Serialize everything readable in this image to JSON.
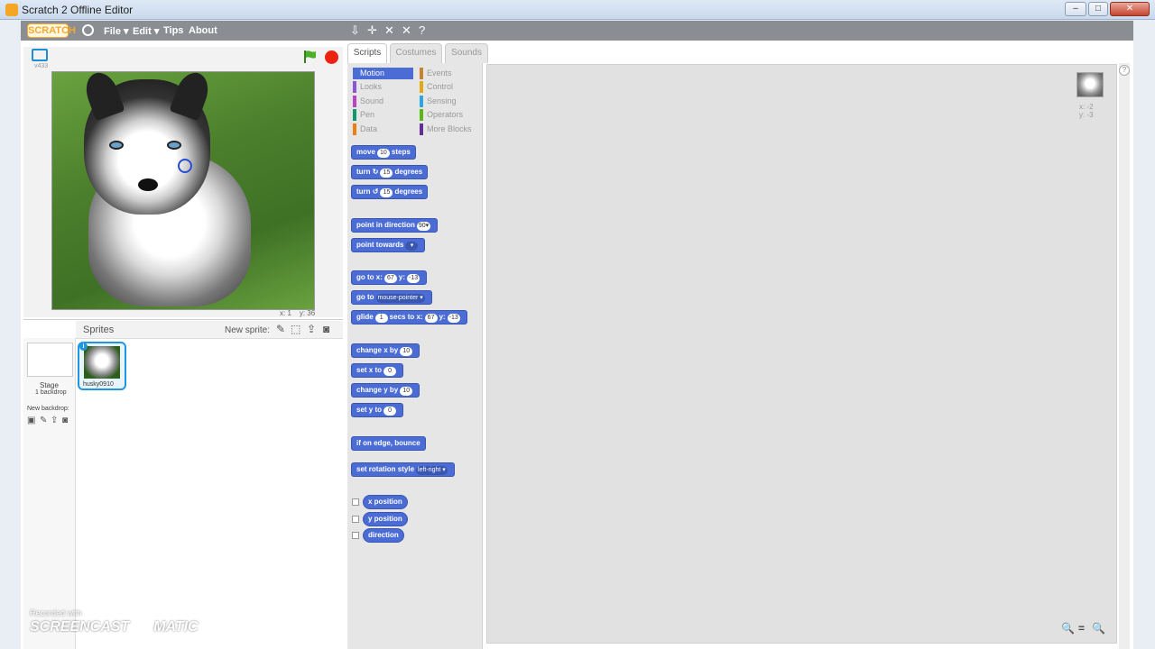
{
  "window": {
    "title": "Scratch 2 Offline Editor",
    "controls": [
      "–",
      "□",
      "✕"
    ]
  },
  "menubar": {
    "logo": "SCRATCH",
    "menus": [
      "File ▾",
      "Edit ▾",
      "Tips",
      "About"
    ],
    "tools": [
      "⇩",
      "✛",
      "✕",
      "✕",
      "?"
    ]
  },
  "stage": {
    "version": "v433",
    "mouse_x_label": "x:",
    "mouse_x": "1",
    "mouse_y_label": "y:",
    "mouse_y": "36"
  },
  "sprites_panel": {
    "title": "Sprites",
    "new_sprite_label": "New sprite:",
    "stage_label": "Stage",
    "backdrop_count": "1 backdrop",
    "new_backdrop_label": "New backdrop:",
    "sprite_name": "husky0910"
  },
  "tabs": [
    "Scripts",
    "Costumes",
    "Sounds"
  ],
  "categories": [
    {
      "label": "Motion",
      "color": "#4a6cd4"
    },
    {
      "label": "Looks",
      "color": "#8a55d7"
    },
    {
      "label": "Sound",
      "color": "#bb42c3"
    },
    {
      "label": "Pen",
      "color": "#0e9a6c"
    },
    {
      "label": "Data",
      "color": "#ee7d16"
    },
    {
      "label": "Events",
      "color": "#c88330"
    },
    {
      "label": "Control",
      "color": "#e1a91a"
    },
    {
      "label": "Sensing",
      "color": "#2ca5e2"
    },
    {
      "label": "Operators",
      "color": "#5cb712"
    },
    {
      "label": "More Blocks",
      "color": "#632d99"
    }
  ],
  "blocks": {
    "move": {
      "a": "move",
      "v": "10",
      "b": "steps"
    },
    "turn_cw": {
      "a": "turn ↻",
      "v": "15",
      "b": "degrees"
    },
    "turn_ccw": {
      "a": "turn ↺",
      "v": "15",
      "b": "degrees"
    },
    "point_dir": {
      "a": "point in direction",
      "v": "90▾"
    },
    "point_towards": {
      "a": "point towards",
      "v": "▾"
    },
    "goto_xy": {
      "a": "go to x:",
      "x": "67",
      "b": "y:",
      "y": "-13"
    },
    "goto": {
      "a": "go to",
      "v": "mouse-pointer ▾"
    },
    "glide": {
      "a": "glide",
      "s": "1",
      "b": "secs to x:",
      "x": "67",
      "c": "y:",
      "y": "-13"
    },
    "change_x": {
      "a": "change x by",
      "v": "10"
    },
    "set_x": {
      "a": "set x to",
      "v": "0"
    },
    "change_y": {
      "a": "change y by",
      "v": "10"
    },
    "set_y": {
      "a": "set y to",
      "v": "0"
    },
    "bounce": {
      "a": "if on edge, bounce"
    },
    "rot_style": {
      "a": "set rotation style",
      "v": "left-right ▾"
    },
    "x_position": "x position",
    "y_position": "y position",
    "direction": "direction"
  },
  "script_area": {
    "sprite_x": "x: -2",
    "sprite_y": "y: -3",
    "zoom": [
      "🔍",
      "=",
      "🔍"
    ]
  },
  "watermark": {
    "line1": "Recorded with",
    "line2": "SCREENCAST",
    "line3": "MATIC"
  }
}
